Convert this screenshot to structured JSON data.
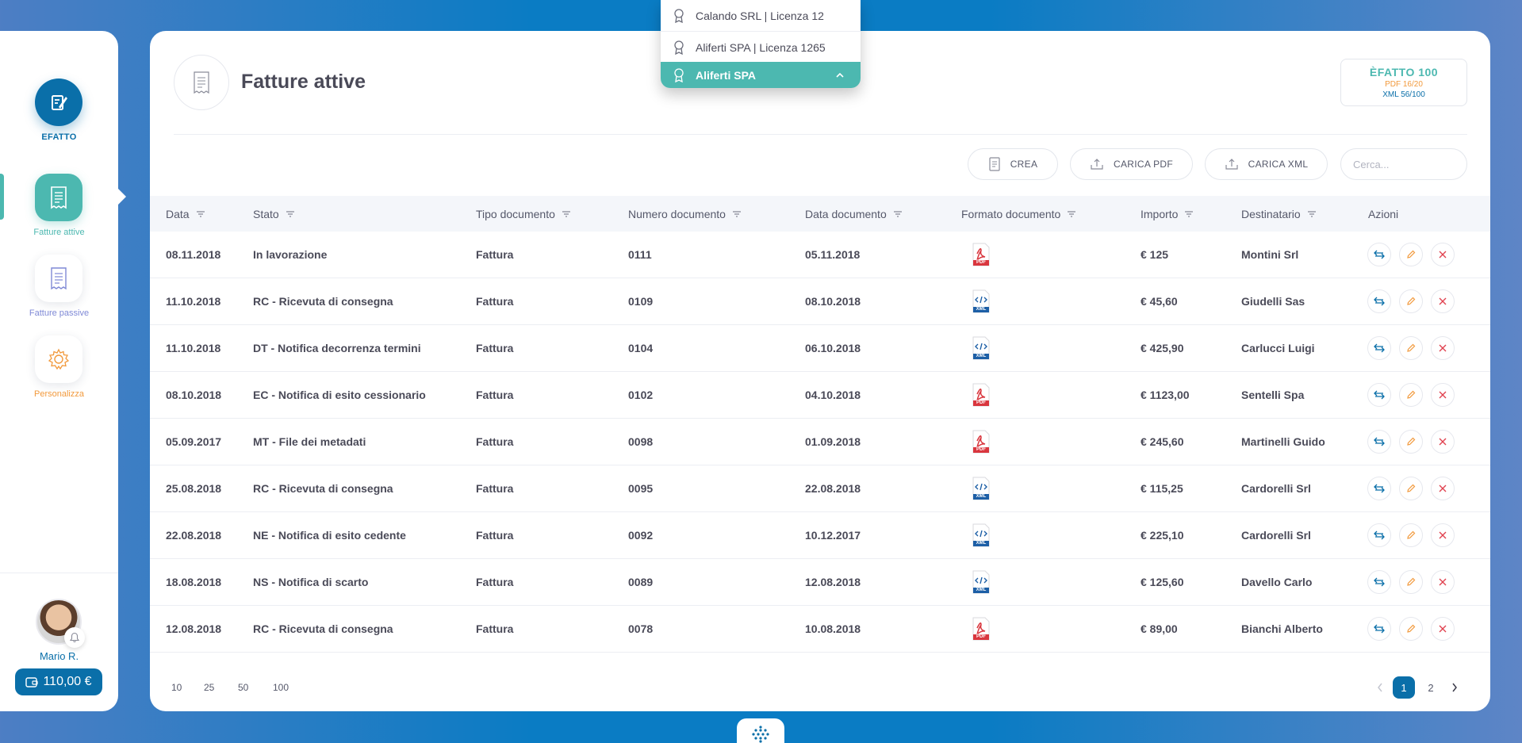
{
  "brand": {
    "label": "EFATTO"
  },
  "sidebar": {
    "items": [
      {
        "label": "Fatture attive",
        "color": "#4cb8b0"
      },
      {
        "label": "Fatture passive",
        "color": "#7f89d6"
      },
      {
        "label": "Personalizza",
        "color": "#f29a3d"
      }
    ]
  },
  "user": {
    "name": "Mario R.",
    "wallet": "110,00 €"
  },
  "page": {
    "title": "Fatture attive"
  },
  "license": {
    "title": "ÈFATTO 100",
    "pdf": "PDF 16/20",
    "xml": "XML 56/100"
  },
  "toolbar": {
    "create": "CREA",
    "upload_pdf": "CARICA PDF",
    "upload_xml": "CARICA XML",
    "search_placeholder": "Cerca..."
  },
  "table": {
    "columns": [
      "Data",
      "Stato",
      "Tipo documento",
      "Numero documento",
      "Data documento",
      "Formato documento",
      "Importo",
      "Destinatario",
      "Azioni"
    ],
    "rows": [
      {
        "data": "08.11.2018",
        "stato": "In lavorazione",
        "tipo": "Fattura",
        "numero": "0111",
        "data_doc": "05.11.2018",
        "formato": "PDF",
        "importo": "€ 125",
        "destinatario": "Montini Srl"
      },
      {
        "data": "11.10.2018",
        "stato": "RC - Ricevuta di consegna",
        "tipo": "Fattura",
        "numero": "0109",
        "data_doc": "08.10.2018",
        "formato": "XML",
        "importo": "€ 45,60",
        "destinatario": "Giudelli Sas"
      },
      {
        "data": "11.10.2018",
        "stato": "DT - Notifica decorrenza termini",
        "tipo": "Fattura",
        "numero": "0104",
        "data_doc": "06.10.2018",
        "formato": "XML",
        "importo": "€ 425,90",
        "destinatario": "Carlucci Luigi"
      },
      {
        "data": "08.10.2018",
        "stato": "EC - Notifica di esito cessionario",
        "tipo": "Fattura",
        "numero": "0102",
        "data_doc": "04.10.2018",
        "formato": "PDF",
        "importo": "€ 1123,00",
        "destinatario": "Sentelli Spa"
      },
      {
        "data": "05.09.2017",
        "stato": "MT - File dei metadati",
        "tipo": "Fattura",
        "numero": "0098",
        "data_doc": "01.09.2018",
        "formato": "PDF",
        "importo": "€ 245,60",
        "destinatario": "Martinelli Guido"
      },
      {
        "data": "25.08.2018",
        "stato": "RC - Ricevuta di consegna",
        "tipo": "Fattura",
        "numero": "0095",
        "data_doc": "22.08.2018",
        "formato": "XML",
        "importo": "€ 115,25",
        "destinatario": "Cardorelli Srl"
      },
      {
        "data": "22.08.2018",
        "stato": "NE - Notifica di esito cedente",
        "tipo": "Fattura",
        "numero": "0092",
        "data_doc": "10.12.2017",
        "formato": "XML",
        "importo": "€ 225,10",
        "destinatario": "Cardorelli Srl"
      },
      {
        "data": "18.08.2018",
        "stato": "NS - Notifica di scarto",
        "tipo": "Fattura",
        "numero": "0089",
        "data_doc": "12.08.2018",
        "formato": "XML",
        "importo": "€ 125,60",
        "destinatario": "Davello Carlo"
      },
      {
        "data": "12.08.2018",
        "stato": "RC - Ricevuta di consegna",
        "tipo": "Fattura",
        "numero": "0078",
        "data_doc": "10.08.2018",
        "formato": "PDF",
        "importo": "€ 89,00",
        "destinatario": "Bianchi Alberto"
      }
    ]
  },
  "pagination": {
    "sizes": [
      "10",
      "25",
      "50",
      "100"
    ],
    "pages": [
      "1",
      "2"
    ],
    "current": "1"
  },
  "dropdown": {
    "items": [
      "Calando SRL | Licenza 12",
      "Aliferti SPA | Licenza 1265"
    ],
    "selected": "Aliferti SPA"
  },
  "colors": {
    "primary": "#0a6fa9",
    "accent": "#4cb8b0",
    "danger": "#e0424f",
    "edit": "#f29a3d",
    "pdf": "#d9363e"
  }
}
